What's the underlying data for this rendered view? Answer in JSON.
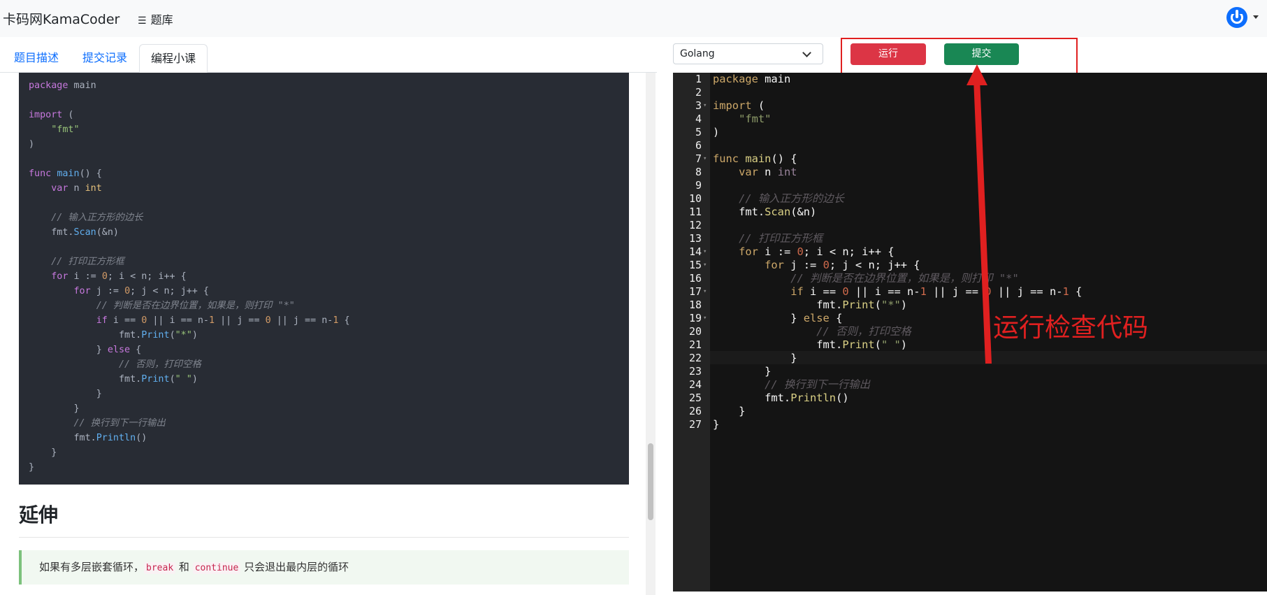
{
  "topbar": {
    "brand": "卡码网KamaCoder",
    "menu_label": "题库"
  },
  "tabs": [
    {
      "label": "题目描述"
    },
    {
      "label": "提交记录"
    },
    {
      "label": "编程小课"
    }
  ],
  "left_code": {
    "code": "package main\n\nimport (\n    \"fmt\"\n)\n\nfunc main() {\n    var n int\n\n    // 输入正方形的边长\n    fmt.Scan(&n)\n\n    // 打印正方形框\n    for i := 0; i < n; i++ {\n        for j := 0; j < n; j++ {\n            // 判断是否在边界位置，如果是，则打印 \"*\"\n            if i == 0 || i == n-1 || j == 0 || j == n-1 {\n                fmt.Print(\"*\")\n            } else {\n                // 否则，打印空格\n                fmt.Print(\" \")\n            }\n        }\n        // 换行到下一行输出\n        fmt.Println()\n    }\n}"
  },
  "extend": {
    "heading": "延伸",
    "tip_prefix": "如果有多层嵌套循环，",
    "tip_code1": "break",
    "tip_mid": " 和 ",
    "tip_code2": "continue",
    "tip_suffix": " 只会退出最内层的循环"
  },
  "editor": {
    "language": "Golang",
    "run_label": "运行",
    "submit_label": "提交",
    "line_count": 27,
    "active_line": 22,
    "code": "package main\n\nimport (\n    \"fmt\"\n)\n\nfunc main() {\n    var n int\n\n    // 输入正方形的边长\n    fmt.Scan(&n)\n\n    // 打印正方形框\n    for i := 0; i < n; i++ {\n        for j := 0; j < n; j++ {\n            // 判断是否在边界位置，如果是，则打印 \"*\"\n            if i == 0 || i == n-1 || j == 0 || j == n-1 {\n                fmt.Print(\"*\")\n            } else {\n                // 否则，打印空格\n                fmt.Print(\" \")\n            }\n        }\n        // 换行到下一行输出\n        fmt.Println()\n    }\n}"
  },
  "annotation": {
    "text": "运行检查代码",
    "color": "#e02020"
  },
  "colors": {
    "run": "#dc3545",
    "submit": "#198754",
    "link": "#0d6efd",
    "editor_bg": "#141414"
  }
}
